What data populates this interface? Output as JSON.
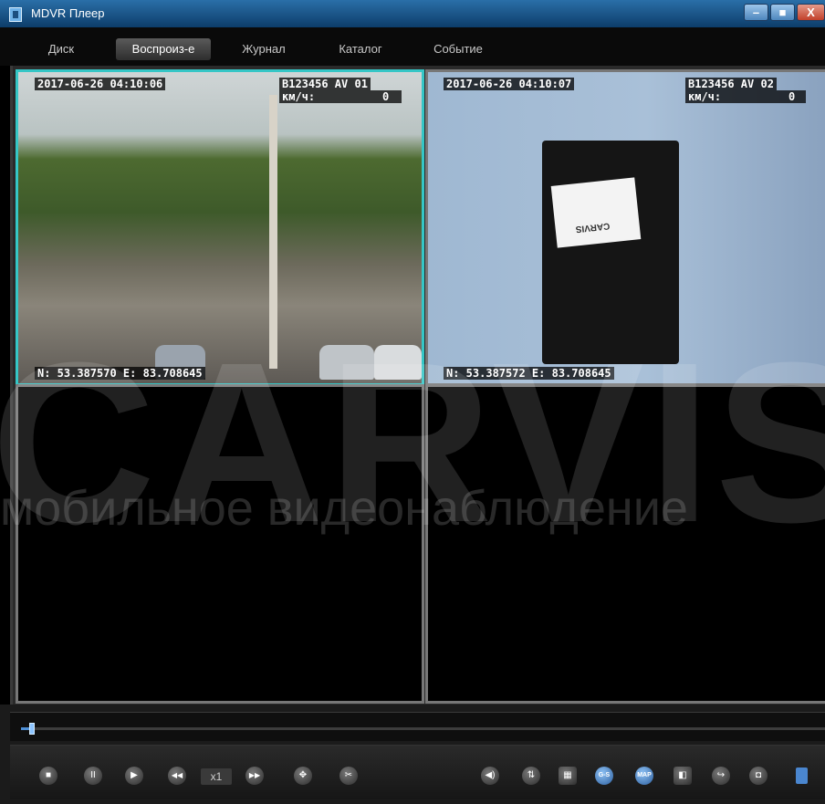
{
  "window": {
    "title": "MDVR Плеер",
    "min_glyph": "–",
    "max_glyph": "■",
    "close_glyph": "X"
  },
  "menu": [
    {
      "label": "Диск"
    },
    {
      "label": "Воспроиз-е",
      "active": true
    },
    {
      "label": "Журнал"
    },
    {
      "label": "Каталог"
    },
    {
      "label": "Событие"
    }
  ],
  "channels": [
    {
      "timestamp": "2017-06-26 04:10:06",
      "device_id": "B123456 AV 01",
      "speed_label": "км/ч:",
      "speed_value": "0",
      "gps": "N: 53.387570 E: 83.708645",
      "selected": true
    },
    {
      "timestamp": "2017-06-26 04:10:07",
      "device_id": "B123456 AV 02",
      "speed_label": "км/ч:",
      "speed_value": "0",
      "gps": "N: 53.387572 E: 83.708645",
      "selected": false
    }
  ],
  "watermark": {
    "brand": "CARVIS",
    "tagline": "мобильное видеонаблюдение"
  },
  "device_label": "CARVIS",
  "playback": {
    "position_fraction": 0.01,
    "speed": "x1"
  },
  "controls": {
    "stop_icon": "■",
    "pause_icon": "II",
    "play_icon": "▶",
    "rewind_icon": "◀◀",
    "forward_icon": "▶▶",
    "gs_label": "G-S",
    "map_label": "MAP"
  },
  "colors": {
    "selected_border": "#35c6c6",
    "accent": "#4e8fd6"
  }
}
